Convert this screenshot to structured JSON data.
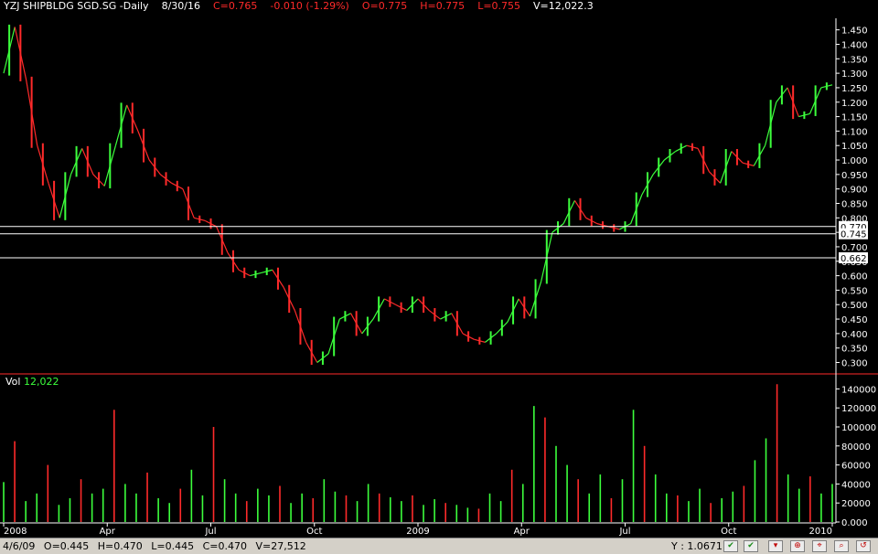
{
  "header": {
    "symbol": "YZJ SHIPBLDG SGD.SG -Daily",
    "date": "8/30/16",
    "close": "C=0.765",
    "change": "-0.010 (-1.29%)",
    "open": "O=0.775",
    "high": "H=0.775",
    "low": "L=0.755",
    "volume": "V=12,022.3"
  },
  "volume_header": {
    "label": "Vol",
    "value": "12,022"
  },
  "status": {
    "date": "4/6/09",
    "open": "O=0.445",
    "high": "H=0.470",
    "low": "L=0.445",
    "close": "C=0.470",
    "volume": "V=27,512",
    "y_readout": "Y : 1.0671"
  },
  "colors": {
    "up": "#3cff3c",
    "down": "#ff2a2a",
    "background": "#000000",
    "axis": "#ffffff",
    "separator": "#ff2a2a"
  },
  "icons": [
    "checkmark-icon",
    "checkmark-icon",
    "chart-tool-icon",
    "chart-tool-icon",
    "chart-tool-icon",
    "chart-tool-icon",
    "chart-tool-icon"
  ],
  "chart_data": [
    {
      "type": "line",
      "title": "YZJ SHIPBLDG SGD.SG -Daily",
      "x_ticks": [
        "2008",
        "Apr",
        "Jul",
        "Oct",
        "2009",
        "Apr",
        "Jul",
        "Oct",
        "2010"
      ],
      "y_ticks": [
        "1.450",
        "1.400",
        "1.350",
        "1.300",
        "1.250",
        "1.200",
        "1.150",
        "1.100",
        "1.050",
        "1.000",
        "0.950",
        "0.900",
        "0.850",
        "0.800",
        "0.750",
        "0.700",
        "0.650",
        "0.600",
        "0.550",
        "0.500",
        "0.450",
        "0.400",
        "0.350",
        "0.300"
      ],
      "ylim": [
        0.27,
        1.49
      ],
      "horizontal_lines": [
        0.77,
        0.745,
        0.662
      ],
      "horizontal_line_labels": [
        "0.770",
        "0.745",
        "0.662"
      ],
      "grid": false,
      "series": [
        {
          "values": [
            1.3,
            1.46,
            1.28,
            1.05,
            0.92,
            0.8,
            0.95,
            1.04,
            0.95,
            0.91,
            1.05,
            1.19,
            1.1,
            1.0,
            0.95,
            0.92,
            0.9,
            0.8,
            0.79,
            0.77,
            0.68,
            0.62,
            0.6,
            0.61,
            0.62,
            0.56,
            0.48,
            0.37,
            0.3,
            0.33,
            0.45,
            0.47,
            0.4,
            0.45,
            0.52,
            0.5,
            0.48,
            0.52,
            0.48,
            0.45,
            0.47,
            0.4,
            0.38,
            0.37,
            0.4,
            0.44,
            0.52,
            0.46,
            0.58,
            0.75,
            0.78,
            0.86,
            0.8,
            0.78,
            0.77,
            0.76,
            0.78,
            0.88,
            0.95,
            1.0,
            1.03,
            1.05,
            1.04,
            0.96,
            0.92,
            1.03,
            0.99,
            0.98,
            1.05,
            1.2,
            1.25,
            1.15,
            1.16,
            1.25,
            1.26
          ]
        }
      ]
    },
    {
      "type": "bar",
      "title": "Vol",
      "y_ticks": [
        "140000",
        "120000",
        "100000",
        "80000",
        "60000",
        "40000",
        "20000",
        "0.000"
      ],
      "ylim": [
        0,
        150000
      ],
      "values": [
        42000,
        85000,
        22000,
        30000,
        60000,
        18000,
        25000,
        45000,
        30000,
        35000,
        118000,
        40000,
        30000,
        52000,
        25000,
        20000,
        35000,
        55000,
        28000,
        100000,
        45000,
        30000,
        22000,
        35000,
        28000,
        38000,
        20000,
        30000,
        25000,
        45000,
        32000,
        28000,
        22000,
        40000,
        30000,
        26000,
        22000,
        28000,
        18000,
        24000,
        20000,
        18000,
        15000,
        14000,
        30000,
        22000,
        55000,
        40000,
        122000,
        110000,
        80000,
        60000,
        45000,
        30000,
        50000,
        25000,
        45000,
        118000,
        80000,
        50000,
        30000,
        28000,
        22000,
        35000,
        20000,
        25000,
        32000,
        38000,
        65000,
        88000,
        145000,
        50000,
        35000,
        48000,
        30000,
        40000
      ]
    }
  ]
}
